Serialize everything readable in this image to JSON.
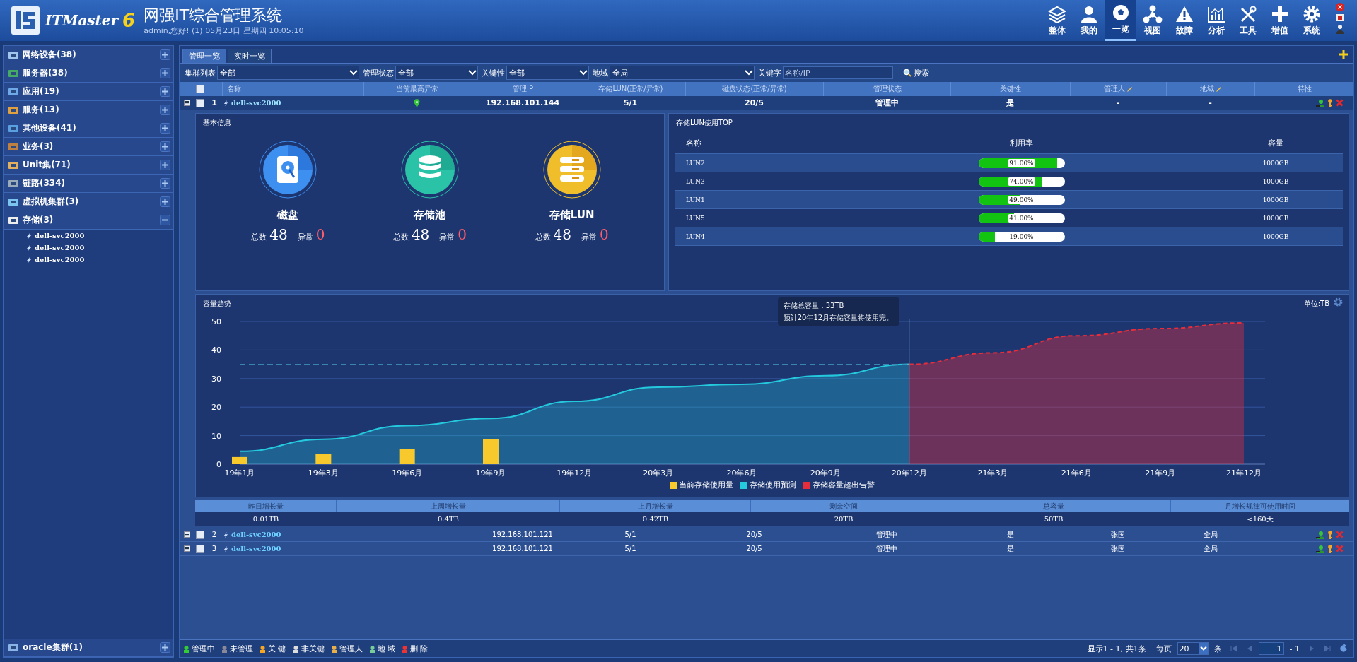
{
  "header": {
    "logo": {
      "brand": "ITMaster",
      "version": "6"
    },
    "title": "网强IT综合管理系统",
    "subtitle": "admin,您好! (1) 05月23日 星期四 10:05:10",
    "nav": [
      {
        "label": "整体",
        "selected": false
      },
      {
        "label": "我的",
        "selected": false
      },
      {
        "label": "一览",
        "selected": true
      },
      {
        "label": "视图",
        "selected": false
      },
      {
        "label": "故障",
        "selected": false
      },
      {
        "label": "分析",
        "selected": false
      },
      {
        "label": "工具",
        "selected": false
      },
      {
        "label": "增值",
        "selected": false
      },
      {
        "label": "系统",
        "selected": false
      }
    ]
  },
  "sidebar": {
    "items": [
      {
        "label": "网络设备(38)",
        "expanded": false
      },
      {
        "label": "服务器(38)",
        "expanded": false
      },
      {
        "label": "应用(19)",
        "expanded": false
      },
      {
        "label": "服务(13)",
        "expanded": false
      },
      {
        "label": "其他设备(41)",
        "expanded": false
      },
      {
        "label": "业务(3)",
        "expanded": false
      },
      {
        "label": "Unit集(71)",
        "expanded": false
      },
      {
        "label": "链路(334)",
        "expanded": false
      },
      {
        "label": "虚拟机集群(3)",
        "expanded": false
      },
      {
        "label": "存储(3)",
        "expanded": true,
        "children": [
          {
            "label": "dell-svc2000"
          },
          {
            "label": "dell-svc2000"
          },
          {
            "label": "dell-svc2000"
          }
        ]
      }
    ],
    "footer_item": {
      "label": "oracle集群(1)",
      "expanded": false
    }
  },
  "tabs": [
    {
      "label": "管理一览",
      "selected": true
    },
    {
      "label": "实时一览",
      "selected": false
    }
  ],
  "filters": [
    {
      "label": "集群列表",
      "value": "全部"
    },
    {
      "label": "管理状态",
      "value": "全部"
    },
    {
      "label": "关键性",
      "value": "全部"
    },
    {
      "label": "地域",
      "value": "全局"
    }
  ],
  "search": {
    "label": "关键字",
    "placeholder": "名称/IP",
    "button": "搜索"
  },
  "table": {
    "header_checked": false,
    "columns": [
      "名称",
      "当前最高异常",
      "管理IP",
      "存储LUN(正常/异常)",
      "磁盘状态(正常/异常)",
      "管理状态",
      "关键性",
      "管理人",
      "地域",
      "特性"
    ],
    "rows": [
      {
        "index": "1",
        "name": "dell-svc2000",
        "alarm": true,
        "ip": "192.168.101.144",
        "lun": "5/1",
        "disk": "20/5",
        "status": "管理中",
        "key": "是",
        "manager": "-",
        "region": "-",
        "checked": false,
        "selected": true,
        "detail": {
          "basic": {
            "title": "基本信息",
            "cards": [
              {
                "kind": "disk",
                "name": "磁盘",
                "total_label": "总数",
                "total": "48",
                "error_label": "异常",
                "errors": "0"
              },
              {
                "kind": "pool",
                "name": "存储池",
                "total_label": "总数",
                "total": "48",
                "error_label": "异常",
                "errors": "0"
              },
              {
                "kind": "lun",
                "name": "存储LUN",
                "total_label": "总数",
                "total": "48",
                "error_label": "异常",
                "errors": "0"
              }
            ]
          },
          "lun_top": {
            "title": "存储LUN使用TOP",
            "columns": [
              "名称",
              "利用率",
              "容量"
            ],
            "rows": [
              {
                "name": "LUN2",
                "level": 0.91,
                "reading": "91.00%",
                "capacity": "1000GB"
              },
              {
                "name": "LUN3",
                "level": 0.74,
                "reading": "74.00%",
                "capacity": "1000GB"
              },
              {
                "name": "LUN1",
                "level": 0.49,
                "reading": "49.00%",
                "capacity": "1000GB"
              },
              {
                "name": "LUN5",
                "level": 0.41,
                "reading": "41.00%",
                "capacity": "1000GB"
              },
              {
                "name": "LUN4",
                "level": 0.19,
                "reading": "19.00%",
                "capacity": "1000GB"
              }
            ]
          },
          "trend": {
            "title": "容量趋势",
            "unit": "单位:TB",
            "chart_data": {
              "type": "area",
              "categories": [
                "19年1月",
                "19年3月",
                "19年6月",
                "19年9月",
                "19年12月",
                "20年3月",
                "20年6月",
                "20年9月",
                "20年12月",
                "21年3月",
                "21年6月",
                "21年9月",
                "21年12月"
              ],
              "ylim": [
                0,
                50
              ],
              "yticks": [
                0,
                10,
                20,
                30,
                40,
                50
              ],
              "grid": true,
              "series": [
                {
                  "name": "当前存储使用量",
                  "color": "#f7c92c",
                  "type": "bar",
                  "values": [
                    2.5,
                    3.7,
                    5.2,
                    8.7,
                    null,
                    null,
                    null,
                    null,
                    null,
                    null,
                    null,
                    null,
                    null
                  ]
                },
                {
                  "name": "存储使用预测",
                  "color": "#25c9de",
                  "type": "area",
                  "values": [
                    4.5,
                    8.7,
                    13.5,
                    16,
                    22,
                    27,
                    28,
                    31,
                    35,
                    null,
                    null,
                    null,
                    null
                  ]
                },
                {
                  "name": "存储容量超出告警",
                  "color": "#e52d3b",
                  "type": "area",
                  "values": [
                    null,
                    null,
                    null,
                    null,
                    null,
                    null,
                    null,
                    null,
                    35,
                    39,
                    45,
                    47.5,
                    49.5
                  ]
                }
              ],
              "ref_lines": [
                {
                  "axis": "y",
                  "value": 35
                },
                {
                  "axis": "x",
                  "value": "20年12月"
                }
              ],
              "annotations": [
                "存储总容量：33TB",
                "预计20年12月存储容量将使用完。"
              ]
            }
          },
          "stats": {
            "columns": [
              "昨日增长量",
              "上周增长量",
              "上月增长量",
              "剩余空间",
              "总容量",
              "月增长规律可使用时间"
            ],
            "values": [
              "0.01TB",
              "0.4TB",
              "0.42TB",
              "20TB",
              "50TB",
              "<160天"
            ]
          }
        }
      },
      {
        "index": "2",
        "name": "dell-svc2000",
        "alarm": false,
        "ip": "192.168.101.121",
        "lun": "5/1",
        "disk": "20/5",
        "status": "管理中",
        "key": "是",
        "manager": "张国",
        "region": "全局",
        "checked": false,
        "selected": false
      },
      {
        "index": "3",
        "name": "dell-svc2000",
        "alarm": false,
        "ip": "192.168.101.121",
        "lun": "5/1",
        "disk": "20/5",
        "status": "管理中",
        "key": "是",
        "manager": "张国",
        "region": "全局",
        "checked": false,
        "selected": false
      }
    ]
  },
  "legend": [
    "管理中",
    "未管理",
    "关 键",
    "非关键",
    "管理人",
    "地 域",
    "删 除"
  ],
  "pager": {
    "summary": "显示1 - 1, 共1条",
    "per_page_label": "每页",
    "per_page": "20",
    "unit": "条",
    "page": "1",
    "total": "- 1"
  }
}
